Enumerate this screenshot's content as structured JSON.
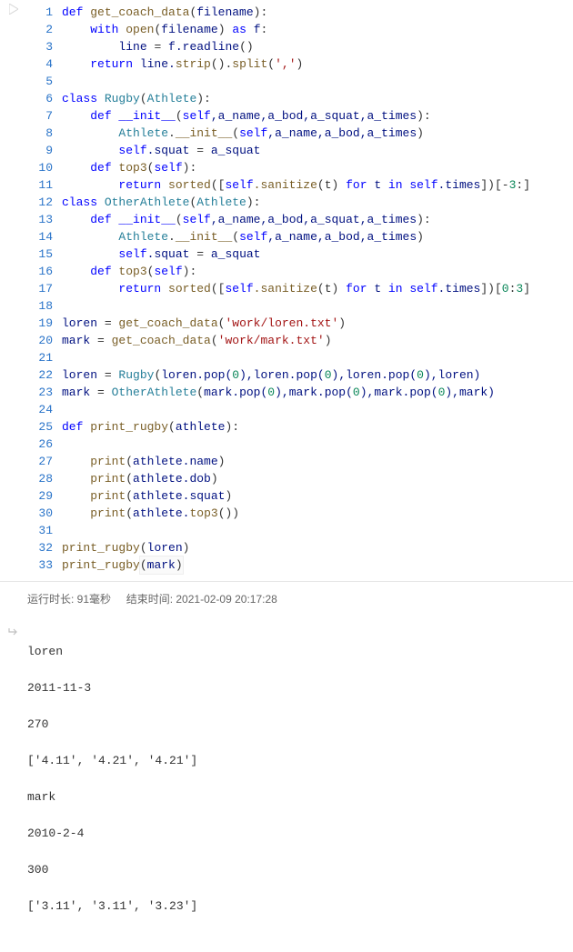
{
  "gutter": [
    "1",
    "2",
    "3",
    "4",
    "5",
    "6",
    "7",
    "8",
    "9",
    "10",
    "11",
    "12",
    "13",
    "14",
    "15",
    "16",
    "17",
    "18",
    "19",
    "20",
    "21",
    "22",
    "23",
    "24",
    "25",
    "26",
    "27",
    "28",
    "29",
    "30",
    "31",
    "32",
    "33"
  ],
  "code": {
    "l1": {
      "kw1": "def",
      "fn": "get_coach_data",
      "p1": "(",
      "v1": "filename",
      "p2": "):"
    },
    "l2": {
      "kw1": "with",
      "fn": "open",
      "p1": "(",
      "v1": "filename",
      "p2": ") ",
      "kw2": "as",
      "v2": " f",
      "p3": ":"
    },
    "l3": {
      "v1": "line ",
      "op": "=",
      "fn": " f.readline",
      "p": "()"
    },
    "l4": {
      "kw": "return",
      "v": " line.",
      "fn1": "strip",
      "p1": "().",
      "fn2": "split",
      "p2": "(",
      "s": "','",
      "p3": ")"
    },
    "l6": {
      "kw": "class",
      "cls": " Rugby",
      "p1": "(",
      "base": "Athlete",
      "p2": "):"
    },
    "l7": {
      "kw": "def",
      "mag": " __init__",
      "p1": "(",
      "self": "self",
      "args": ",a_name,a_bod,a_squat,a_times",
      "p2": "):"
    },
    "l8": {
      "cls": "Athlete",
      "dot": ".",
      "mag": "__init__",
      "p1": "(",
      "self": "self",
      "args": ",a_name,a_bod,a_times",
      "p2": ")"
    },
    "l9": {
      "self": "self",
      "prop": ".squat ",
      "op": "=",
      "v": " a_squat"
    },
    "l10": {
      "kw": "def",
      "fn": " top3",
      "p1": "(",
      "self": "self",
      "p2": "):"
    },
    "l11": {
      "kw": "return",
      "fn": " sorted",
      "p1": "([",
      "self": "self",
      "m": ".sanitize",
      "p2": "(t) ",
      "kw2": "for",
      "v1": " t ",
      "kw3": "in",
      "self2": " self",
      "prop": ".times",
      "p3": "])[",
      "n1": "-",
      "n2": "3",
      "p4": ":]"
    },
    "l12": {
      "kw": "class",
      "cls": " OtherAthlete",
      "p1": "(",
      "base": "Athlete",
      "p2": "):"
    },
    "l13": {
      "kw": "def",
      "mag": " __init__",
      "p1": "(",
      "self": "self",
      "args": ",a_name,a_bod,a_squat,a_times",
      "p2": "):"
    },
    "l14": {
      "cls": "Athlete",
      "dot": ".",
      "mag": "__init__",
      "p1": "(",
      "self": "self",
      "args": ",a_name,a_bod,a_times",
      "p2": ")"
    },
    "l15": {
      "self": "self",
      "prop": ".squat ",
      "op": "=",
      "v": " a_squat"
    },
    "l16": {
      "kw": "def",
      "fn": " top3",
      "p1": "(",
      "self": "self",
      "p2": "):"
    },
    "l17": {
      "kw": "return",
      "fn": " sorted",
      "p1": "([",
      "self": "self",
      "m": ".sanitize",
      "p2": "(t) ",
      "kw2": "for",
      "v1": " t ",
      "kw3": "in",
      "self2": " self",
      "prop": ".times",
      "p3": "])[",
      "n1": "0",
      "c": ":",
      "n2": "3",
      "p4": "]"
    },
    "l19": {
      "v": "loren ",
      "op": "=",
      "fn": " get_coach_data",
      "p1": "(",
      "s": "'work/loren.txt'",
      "p2": ")"
    },
    "l20": {
      "v": "mark ",
      "op": "=",
      "fn": " get_coach_data",
      "p1": "(",
      "s": "'work/mark.txt'",
      "p2": ")"
    },
    "l22": {
      "v": "loren ",
      "op": "=",
      "cls": " Rugby",
      "p1": "(",
      "args": "loren.pop(",
      "n": "0",
      "a2": "),loren.pop(",
      "n2": "0",
      "a3": "),loren.pop(",
      "n3": "0",
      "a4": "),loren)"
    },
    "l23": {
      "v": "mark ",
      "op": "=",
      "cls": " OtherAthlete",
      "p1": "(",
      "args": "mark.pop(",
      "n": "0",
      "a2": "),mark.pop(",
      "n2": "0",
      "a3": "),mark.pop(",
      "n3": "0",
      "a4": "),mark)"
    },
    "l25": {
      "kw": "def",
      "fn": " print_rugby",
      "p1": "(",
      "v": "athlete",
      "p2": "):"
    },
    "l27": {
      "fn": "print",
      "p1": "(",
      "v": "athlete.name",
      "p2": ")"
    },
    "l28": {
      "fn": "print",
      "p1": "(",
      "v": "athlete.dob",
      "p2": ")"
    },
    "l29": {
      "fn": "print",
      "p1": "(",
      "v": "athlete.squat",
      "p2": ")"
    },
    "l30": {
      "fn": "print",
      "p1": "(",
      "v": "athlete.",
      "m": "top3",
      "p2": "())"
    },
    "l32": {
      "fn": "print_rugby",
      "p1": "(",
      "v": "loren",
      "p2": ")"
    },
    "l33": {
      "fn": "print_rugby",
      "p1": "(",
      "v": "mark",
      "p2": ")"
    }
  },
  "status": {
    "runtime_label": "运行时长: ",
    "runtime_value": "91毫秒",
    "endtime_label": "结束时间: ",
    "endtime_value": "2021-02-09 20:17:28"
  },
  "output": [
    "loren",
    "2011-11-3",
    "270",
    "['4.11', '4.21', '4.21']",
    "mark",
    "2010-2-4",
    "300",
    "['3.11', '3.11', '3.23']"
  ]
}
